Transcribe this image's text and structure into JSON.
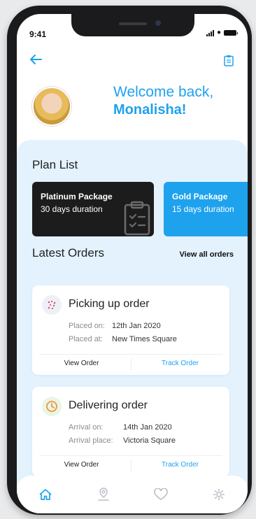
{
  "status_bar": {
    "time": "9:41"
  },
  "header": {
    "welcome_line1": "Welcome back,",
    "welcome_name": "Monalisha!"
  },
  "plan_list": {
    "title": "Plan List",
    "plans": [
      {
        "name": "Platinum Package",
        "duration": "30 days duration",
        "color": "#1c1c1c"
      },
      {
        "name": "Gold Package",
        "duration": "15 days duration",
        "color": "#1ea2ee"
      }
    ]
  },
  "latest_orders": {
    "title": "Latest Orders",
    "view_all_label": "View all orders",
    "orders": [
      {
        "title": "Picking up order",
        "icon": "scatter-dots-icon",
        "fields": [
          {
            "label": "Placed on:",
            "value": "12th Jan 2020"
          },
          {
            "label": "Placed at:",
            "value": "New Times Square"
          }
        ],
        "view_label": "View Order",
        "track_label": "Track Order"
      },
      {
        "title": "Delivering order",
        "icon": "clock-icon",
        "fields": [
          {
            "label": "Arrival on:",
            "value": "14th Jan 2020"
          },
          {
            "label": "Arrival place:",
            "value": "Victoria Square"
          }
        ],
        "view_label": "View Order",
        "track_label": "Track Order"
      }
    ]
  },
  "tabbar": {
    "items": [
      "home-icon",
      "location-icon",
      "heart-icon",
      "gear-icon"
    ],
    "active": "home-icon"
  },
  "colors": {
    "accent": "#1ea2ee",
    "panel_bg": "#e3f2fd",
    "dark_card": "#1c1c1c"
  }
}
